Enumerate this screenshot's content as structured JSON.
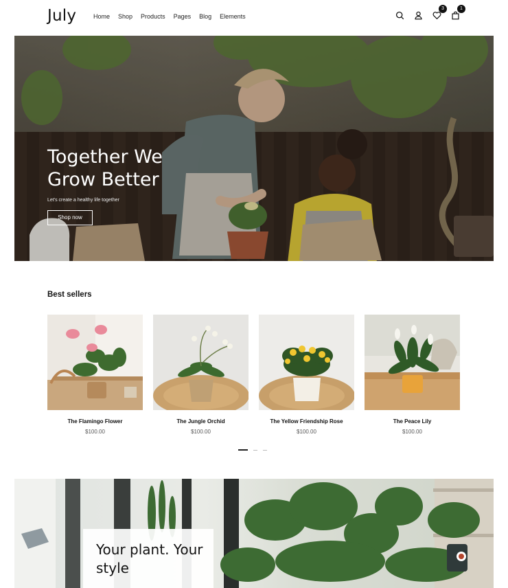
{
  "header": {
    "logo": "July",
    "nav": [
      "Home",
      "Shop",
      "Products",
      "Pages",
      "Blog",
      "Elements"
    ],
    "icons": [
      "search-icon",
      "user-icon",
      "heart-icon",
      "bag-icon"
    ],
    "wishlist_count": "3",
    "cart_count": "1"
  },
  "hero": {
    "title": "Together We Grow Better",
    "subtitle": "Let's create a healthy life together",
    "button": "Shop now"
  },
  "best_sellers": {
    "title": "Best sellers",
    "products": [
      {
        "name": "The Flamingo Flower",
        "price": "$100.00"
      },
      {
        "name": "The Jungle Orchid",
        "price": "$100.00"
      },
      {
        "name": "The Yellow Friendship Rose",
        "price": "$100.00"
      },
      {
        "name": "The Peace Lily",
        "price": "$100.00"
      }
    ],
    "pagination_pages": 3,
    "pagination_active": 1
  },
  "banner": {
    "title": "Your plant. Your style"
  },
  "colors": {
    "text": "#111111",
    "price": "#555555",
    "badge": "#111111",
    "hotspot": "#b4452d"
  }
}
